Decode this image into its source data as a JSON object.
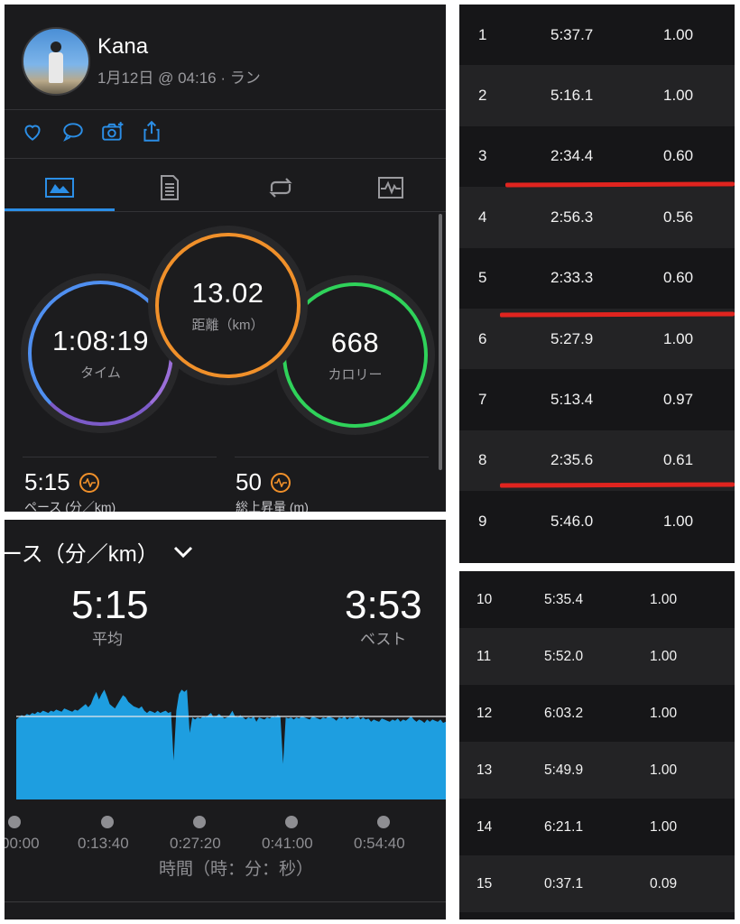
{
  "activity": {
    "user_name": "Kana",
    "meta": "1月12日 @ 04:16 · ラン",
    "action_icons": [
      "heart-icon",
      "comment-icon",
      "add-photo-icon",
      "share-icon"
    ],
    "tab_icons": [
      "overview-icon",
      "details-icon",
      "laps-icon",
      "charts-icon"
    ],
    "rings": {
      "time": {
        "value": "1:08:19",
        "label": "タイム"
      },
      "distance": {
        "value": "13.02",
        "label": "距離（km）"
      },
      "calories": {
        "value": "668",
        "label": "カロリー"
      }
    },
    "stats": {
      "pace": {
        "value": "5:15",
        "label": "ペース (分／km)"
      },
      "elevation": {
        "value": "50",
        "label": "総上昇量 (m)"
      }
    },
    "colors": {
      "accent": "#2b8ee6",
      "time_ring": "#4f8ff0",
      "distance_ring": "#f0902a",
      "calorie_ring": "#2fd25a"
    }
  },
  "pace_chart": {
    "title": "ース（分／km）",
    "average": {
      "value": "5:15",
      "label": "平均"
    },
    "best": {
      "value": "3:53",
      "label": "ベスト"
    },
    "x_ticks": [
      "00:00",
      "0:13:40",
      "0:27:20",
      "0:41:00",
      "0:54:40"
    ],
    "x_title": "時間（時：分：秒）",
    "color": "#1e9ee0"
  },
  "chart_data": {
    "type": "area",
    "title": "",
    "xlabel": "時間（時：分：秒）",
    "ylabel": "ース（分／km）",
    "x_ticks": [
      "00:00",
      "0:13:40",
      "0:27:20",
      "0:41:00",
      "0:54:40"
    ],
    "average_line": "5:15",
    "profile": [
      0.72,
      0.74,
      0.76,
      0.75,
      0.77,
      0.76,
      0.78,
      0.77,
      0.79,
      0.78,
      0.8,
      0.79,
      0.78,
      0.8,
      0.79,
      0.81,
      0.8,
      0.79,
      0.82,
      0.81,
      0.8,
      0.79,
      0.81,
      0.8,
      0.82,
      0.84,
      0.86,
      0.83,
      0.86,
      0.92,
      0.97,
      0.9,
      0.95,
      0.99,
      0.93,
      0.86,
      0.84,
      0.82,
      0.86,
      0.9,
      0.94,
      0.92,
      0.88,
      0.86,
      0.84,
      0.83,
      0.82,
      0.84,
      0.8,
      0.78,
      0.8,
      0.79,
      0.78,
      0.8,
      0.78,
      0.79,
      0.8,
      0.78,
      0.79,
      0.35,
      0.8,
      0.95,
      0.99,
      0.97,
      0.99,
      0.6,
      0.74,
      0.72,
      0.74,
      0.73,
      0.75,
      0.74,
      0.76,
      0.78,
      0.74,
      0.75,
      0.77,
      0.75,
      0.73,
      0.74,
      0.76,
      0.8,
      0.75,
      0.74,
      0.76,
      0.74,
      0.72,
      0.74,
      0.73,
      0.75,
      0.7,
      0.74,
      0.73,
      0.72,
      0.74,
      0.73,
      0.75,
      0.74,
      0.76,
      0.75,
      0.32,
      0.74,
      0.73,
      0.74,
      0.72,
      0.74,
      0.73,
      0.75,
      0.74,
      0.73,
      0.72,
      0.75,
      0.74,
      0.73,
      0.72,
      0.74,
      0.73,
      0.75,
      0.74,
      0.73,
      0.71,
      0.74,
      0.73,
      0.75,
      0.72,
      0.74,
      0.73,
      0.74,
      0.76,
      0.72,
      0.74,
      0.72,
      0.73,
      0.7,
      0.72,
      0.71,
      0.7,
      0.73,
      0.72,
      0.71,
      0.7,
      0.72,
      0.71,
      0.73,
      0.7,
      0.72,
      0.71,
      0.73,
      0.75,
      0.72,
      0.7,
      0.72,
      0.71,
      0.69,
      0.72,
      0.7,
      0.72,
      0.71,
      0.7,
      0.72,
      0.69,
      0.7
    ]
  },
  "laps_table_1": [
    {
      "n": "1",
      "time": "5:37.7",
      "dist": "1.00"
    },
    {
      "n": "2",
      "time": "5:16.1",
      "dist": "1.00"
    },
    {
      "n": "3",
      "time": "2:34.4",
      "dist": "0.60"
    },
    {
      "n": "4",
      "time": "2:56.3",
      "dist": "0.56"
    },
    {
      "n": "5",
      "time": "2:33.3",
      "dist": "0.60"
    },
    {
      "n": "6",
      "time": "5:27.9",
      "dist": "1.00"
    },
    {
      "n": "7",
      "time": "5:13.4",
      "dist": "0.97"
    },
    {
      "n": "8",
      "time": "2:35.6",
      "dist": "0.61"
    },
    {
      "n": "9",
      "time": "5:46.0",
      "dist": "1.00"
    }
  ],
  "laps_table_2": [
    {
      "n": "10",
      "time": "5:35.4",
      "dist": "1.00"
    },
    {
      "n": "11",
      "time": "5:52.0",
      "dist": "1.00"
    },
    {
      "n": "12",
      "time": "6:03.2",
      "dist": "1.00"
    },
    {
      "n": "13",
      "time": "5:49.9",
      "dist": "1.00"
    },
    {
      "n": "14",
      "time": "6:21.1",
      "dist": "1.00"
    },
    {
      "n": "15",
      "time": "0:37.1",
      "dist": "0.09"
    }
  ],
  "annotation_color": "#e0241f"
}
